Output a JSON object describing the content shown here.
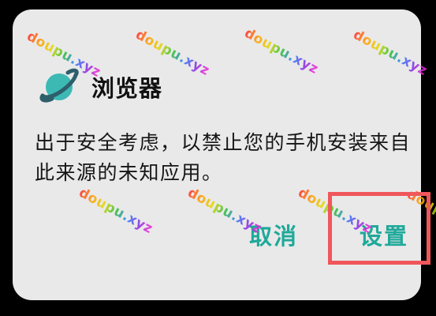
{
  "dialog": {
    "app_name": "浏览器",
    "message": "出于安全考虑，以禁止您的手机安装来自此来源的未知应用。",
    "cancel_label": "取消",
    "settings_label": "设置",
    "app_icon": "planet-icon"
  },
  "watermark": {
    "text": "doupu.xyz"
  },
  "colors": {
    "dialog_bg": "#e9e9e9",
    "accent": "#1fa99a",
    "highlight": "#f0575b",
    "icon_planet": "#3db9b4",
    "icon_ring": "#2d5f6b"
  }
}
